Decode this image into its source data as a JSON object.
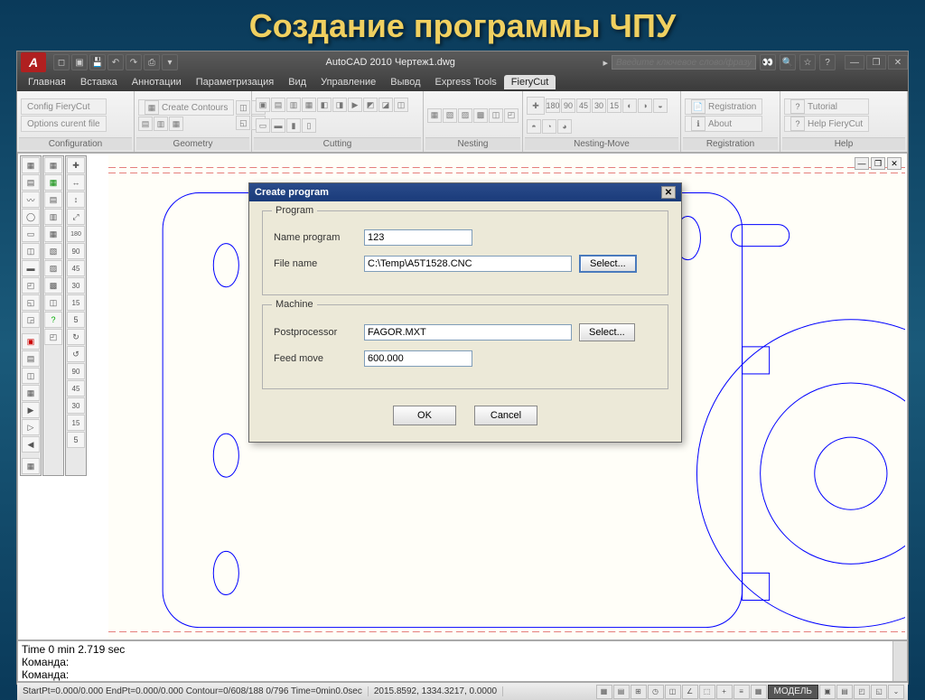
{
  "slide_title": "Создание программы ЧПУ",
  "titlebar": {
    "app_title": "AutoCAD 2010    Чертеж1.dwg",
    "search_placeholder": "Введите ключевое слово/фразу"
  },
  "menubar": [
    "Главная",
    "Вставка",
    "Аннотации",
    "Параметризация",
    "Вид",
    "Управление",
    "Вывод",
    "Express Tools",
    "FieryCut"
  ],
  "menubar_active": 8,
  "ribbon": {
    "panels": [
      {
        "label": "Configuration",
        "items": [
          "Config FieryCut",
          "Options curent file"
        ]
      },
      {
        "label": "Geometry",
        "items": [
          "Create Contours"
        ]
      },
      {
        "label": "Cutting",
        "items": []
      },
      {
        "label": "Nesting",
        "items": []
      },
      {
        "label": "Nesting-Move",
        "items": []
      },
      {
        "label": "Registration",
        "items": [
          "Registration",
          "About"
        ]
      },
      {
        "label": "Help",
        "items": [
          "Tutorial",
          "Help FieryCut"
        ]
      }
    ]
  },
  "dialog": {
    "title": "Create program",
    "group1": "Program",
    "name_program_label": "Name program",
    "name_program_value": "123",
    "file_name_label": "File name",
    "file_name_value": "C:\\Temp\\A5T1528.CNC",
    "select1": "Select...",
    "group2": "Machine",
    "postprocessor_label": "Postprocessor",
    "postprocessor_value": "FAGOR.MXT",
    "select2": "Select...",
    "feed_label": "Feed move",
    "feed_value": "600.000",
    "ok": "OK",
    "cancel": "Cancel"
  },
  "cmdline": {
    "line1": "Time   0 min 2.719 sec",
    "line2": "Команда:",
    "line3": "Команда:"
  },
  "statusbar": {
    "left": "StartPt=0.000/0.000  EndPt=0.000/0.000  Contour=0/608/188  0/796  Time=0min0.0sec",
    "coords": "2015.8592, 1334.3217, 0.0000",
    "model": "МОДЕЛЬ"
  }
}
